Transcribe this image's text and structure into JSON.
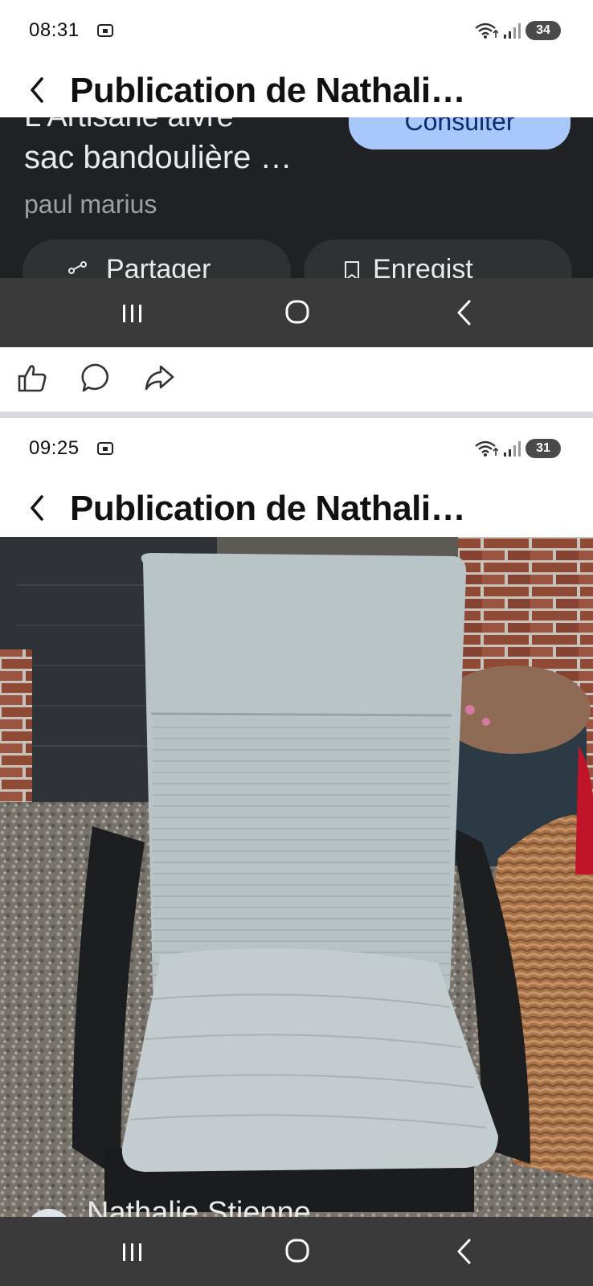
{
  "screenshot1": {
    "status": {
      "time": "08:31",
      "battery": "34"
    },
    "header": {
      "title": "Publication de Nathali…"
    },
    "card": {
      "cut_text": "L'Artisane alvre",
      "consult_button": "Consulter",
      "title": "sac bandoulière …",
      "author": "paul marius",
      "share_button": "Partager",
      "save_button": "Enregist"
    }
  },
  "screenshot2": {
    "status": {
      "time": "09:25",
      "battery": "31"
    },
    "header": {
      "title": "Publication de Nathali…"
    },
    "photo": {
      "author_overlay": "Nathalie Stienne"
    }
  },
  "icons": {
    "status": [
      "screen-capture-icon",
      "wifi-icon",
      "signal-icon",
      "battery-icon"
    ],
    "navigation": [
      "recent-apps-icon",
      "home-icon",
      "back-icon"
    ],
    "actions": [
      "like-icon",
      "comment-icon",
      "share-icon"
    ]
  },
  "colors": {
    "dark_card_bg": "#202124",
    "consult_button_bg": "#a8c7fa",
    "navbar_bg": "#3a3a3a",
    "cushion": "#b9c4c6"
  }
}
